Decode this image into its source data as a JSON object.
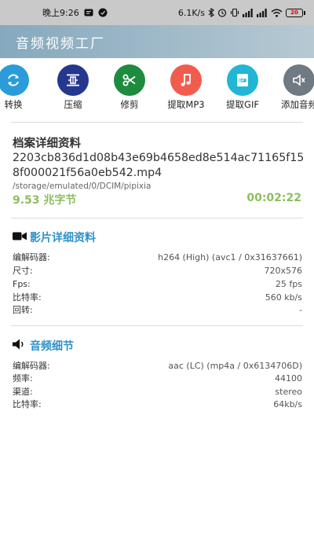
{
  "status_bar": {
    "time": "晚上9:26",
    "speed": "6.1K/s",
    "battery": "20",
    "icons": [
      "message-badge-icon",
      "app-notification-icon",
      "bluetooth-icon",
      "alarm-icon",
      "vibrate-icon",
      "signal-icon",
      "signal-icon-2",
      "wifi-icon",
      "battery-icon"
    ]
  },
  "app_bar": {
    "title": "音频视频工厂"
  },
  "tools": [
    {
      "label": "转换",
      "icon": "convert-icon",
      "color": "#2b9cd9"
    },
    {
      "label": "压缩",
      "icon": "compress-icon",
      "color": "#26378e"
    },
    {
      "label": "修剪",
      "icon": "scissors-icon",
      "color": "#1e8b3e"
    },
    {
      "label": "提取MP3",
      "icon": "music-note-icon",
      "color": "#f25c4e"
    },
    {
      "label": "提取GIF",
      "icon": "gif-icon",
      "color": "#20b6d4"
    },
    {
      "label": "添加音频",
      "icon": "speaker-icon",
      "color": "#6f7a82"
    }
  ],
  "file_details": {
    "title": "档案详细资料",
    "file_name": "2203cb836d1d08b43e69b4658ed8e514ac71165f158f000021f56a0eb542.mp4",
    "path": "/storage/emulated/0/DCIM/pipixia",
    "size": "9.53 兆字节",
    "duration": "00:02:22"
  },
  "video_details": {
    "title": "影片详细资料",
    "rows": [
      {
        "label": "编解码器:",
        "value": "h264 (High) (avc1 / 0x31637661)"
      },
      {
        "label": "尺寸:",
        "value": "720x576"
      },
      {
        "label": "Fps:",
        "value": "25 fps"
      },
      {
        "label": "比特率:",
        "value": "560 kb/s"
      },
      {
        "label": "回转:",
        "value": "-"
      }
    ]
  },
  "audio_details": {
    "title": "音频细节",
    "rows": [
      {
        "label": "编解码器:",
        "value": "aac (LC) (mp4a / 0x6134706D)"
      },
      {
        "label": "频率:",
        "value": "44100"
      },
      {
        "label": "渠道:",
        "value": "stereo"
      },
      {
        "label": "比特率:",
        "value": "64kb/s"
      }
    ]
  }
}
